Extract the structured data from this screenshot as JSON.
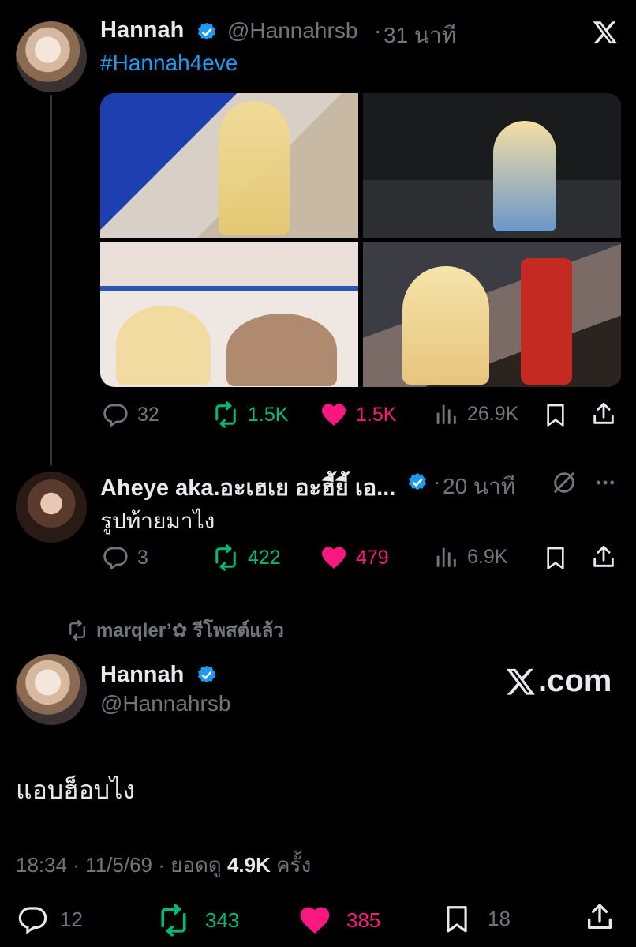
{
  "tweet1": {
    "display_name": "Hannah",
    "handle": "@Hannahrsb",
    "time": "31 นาที",
    "hashtag": "#Hannah4eve",
    "stats": {
      "replies": "32",
      "reposts": "1.5K",
      "likes": "1.5K",
      "views": "26.9K"
    }
  },
  "reply": {
    "display_name": "Aheye aka.อะเฮเย อะฮี้ยี้ เอ...",
    "time": "20 นาที",
    "text": "รูปท้ายมาไง",
    "stats": {
      "replies": "3",
      "reposts": "422",
      "likes": "479",
      "views": "6.9K"
    }
  },
  "repost_notice": {
    "text": "marqler’✿ รีโพสต์แล้ว"
  },
  "tweet2": {
    "display_name": "Hannah",
    "handle": "@Hannahrsb",
    "brand": ".com",
    "text": "แอบฮ็อบไง",
    "meta_time": "18:34 · 11/5/69 · ยอดดู",
    "meta_views": "4.9K",
    "meta_suffix": "ครั้ง",
    "stats": {
      "replies": "12",
      "reposts": "343",
      "likes": "385",
      "bookmarks": "18"
    }
  },
  "colors": {
    "accent": "#1d9bf0",
    "green": "#00ba7c",
    "pink": "#f91880",
    "muted": "#71767b"
  },
  "icons": [
    "x-logo-icon",
    "verified-badge-icon",
    "reply-icon",
    "repost-icon",
    "like-icon",
    "views-icon",
    "bookmark-icon",
    "share-icon",
    "grok-icon",
    "more-icon"
  ]
}
